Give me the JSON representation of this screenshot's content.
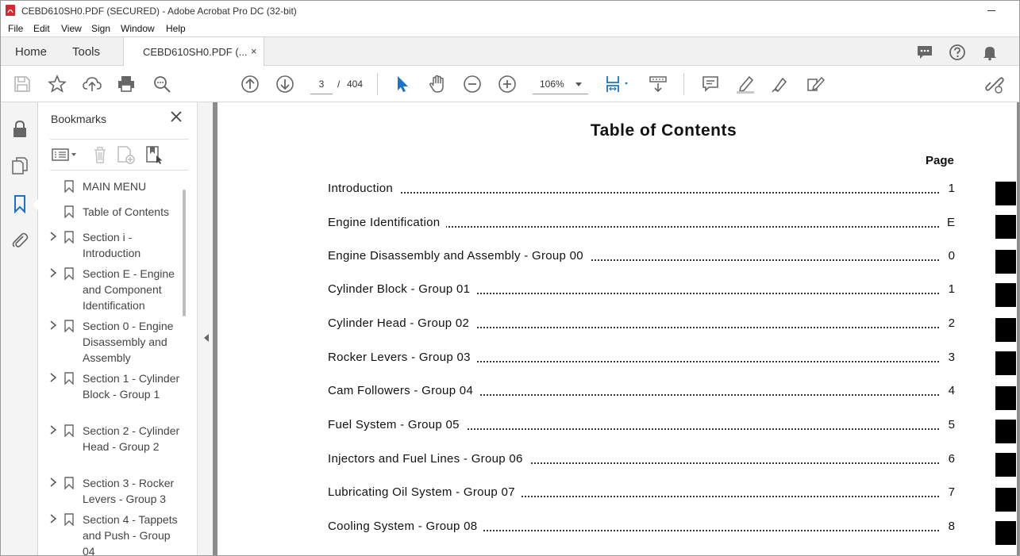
{
  "window": {
    "title": "CEBD610SH0.PDF (SECURED) - Adobe Acrobat Pro DC (32-bit)"
  },
  "menu": [
    "File",
    "Edit",
    "View",
    "Sign",
    "Window",
    "Help"
  ],
  "tabs": {
    "home": "Home",
    "tools": "Tools",
    "document": "CEBD610SH0.PDF (...",
    "close": "×"
  },
  "toolbar": {
    "page_current": "3",
    "page_separator": "/",
    "page_total": "404",
    "zoom": "106%"
  },
  "bookmarks": {
    "title": "Bookmarks",
    "items": [
      {
        "label": "MAIN MENU",
        "expandable": false
      },
      {
        "label": "Table of Contents",
        "expandable": false
      },
      {
        "label": "Section i - Introduction",
        "expandable": true
      },
      {
        "label": "Section E - Engine and Component Identification",
        "expandable": true
      },
      {
        "label": "Section 0 - Engine Disassembly and Assembly",
        "expandable": true
      },
      {
        "label": "Section 1 - Cylinder Block - Group 1",
        "expandable": true
      },
      {
        "label": "Section 2 - Cylinder Head - Group 2",
        "expandable": true
      },
      {
        "label": "Section 3 - Rocker Levers - Group 3",
        "expandable": true
      },
      {
        "label": "Section 4 - Tappets and Push - Group 04",
        "expandable": true
      }
    ]
  },
  "document": {
    "title": "Table of Contents",
    "page_header": "Page",
    "toc": [
      {
        "label": "Introduction",
        "page": "1"
      },
      {
        "label": "Engine Identification",
        "page": "E"
      },
      {
        "label": "Engine Disassembly and Assembly - Group 00",
        "page": "0"
      },
      {
        "label": "Cylinder Block - Group 01",
        "page": "1"
      },
      {
        "label": "Cylinder Head - Group 02",
        "page": "2"
      },
      {
        "label": "Rocker Levers - Group 03",
        "page": "3"
      },
      {
        "label": "Cam Followers - Group 04",
        "page": "4"
      },
      {
        "label": "Fuel System - Group 05",
        "page": "5"
      },
      {
        "label": "Injectors and Fuel Lines - Group 06",
        "page": "6"
      },
      {
        "label": "Lubricating Oil System - Group 07",
        "page": "7"
      },
      {
        "label": "Cooling System - Group 08",
        "page": "8"
      }
    ]
  },
  "colors": {
    "accent_blue": "#1a73c8",
    "app_red": "#d7282f",
    "icon_gray": "#6b6b6b"
  }
}
